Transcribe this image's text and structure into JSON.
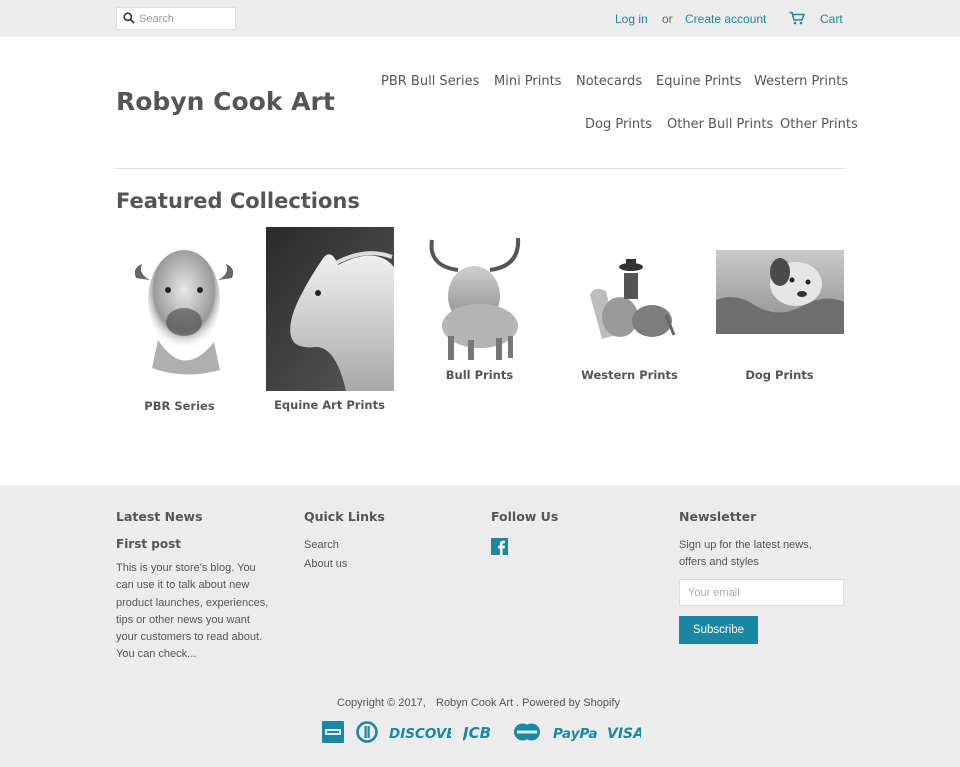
{
  "topbar": {
    "search_placeholder": "Search",
    "login": "Log in",
    "or": "or",
    "create_account": "Create account",
    "cart": "Cart"
  },
  "header": {
    "logo": "Robyn Cook Art",
    "nav": [
      "PBR Bull Series",
      "Mini Prints",
      "Notecards",
      "Equine Prints",
      "Western Prints",
      "Dog Prints",
      "Other Bull Prints",
      "Other Prints"
    ]
  },
  "featured": {
    "title": "Featured Collections",
    "items": [
      {
        "label": "PBR Series"
      },
      {
        "label": "Equine Art Prints"
      },
      {
        "label": "Bull Prints"
      },
      {
        "label": "Western Prints"
      },
      {
        "label": "Dog Prints"
      }
    ]
  },
  "footer": {
    "news": {
      "heading": "Latest News",
      "post_title": "First post",
      "lines": [
        "This is your store's blog. You",
        "can use it to talk about new",
        "product launches, experiences,",
        "tips or other news you want",
        "your customers to read about.",
        "You can check..."
      ]
    },
    "quick_links": {
      "heading": "Quick Links",
      "links": [
        "Search",
        "About us"
      ]
    },
    "follow": {
      "heading": "Follow Us",
      "icon": "facebook-icon"
    },
    "newsletter": {
      "heading": "Newsletter",
      "lines": [
        "Sign up for the latest news,",
        "offers and styles"
      ],
      "placeholder": "Your email",
      "button": "Subscribe"
    },
    "copyright": "Copyright © 2017,",
    "store": "Robyn Cook Art",
    "powered": ". Powered by Shopify",
    "payments": [
      "American Express",
      "Diners Club",
      "DISCOVER",
      "JCB",
      "MasterCard",
      "PayPal",
      "VISA"
    ]
  },
  "colors": {
    "accent": "#1a88a5",
    "bar": "#ececec",
    "text": "#555555"
  }
}
